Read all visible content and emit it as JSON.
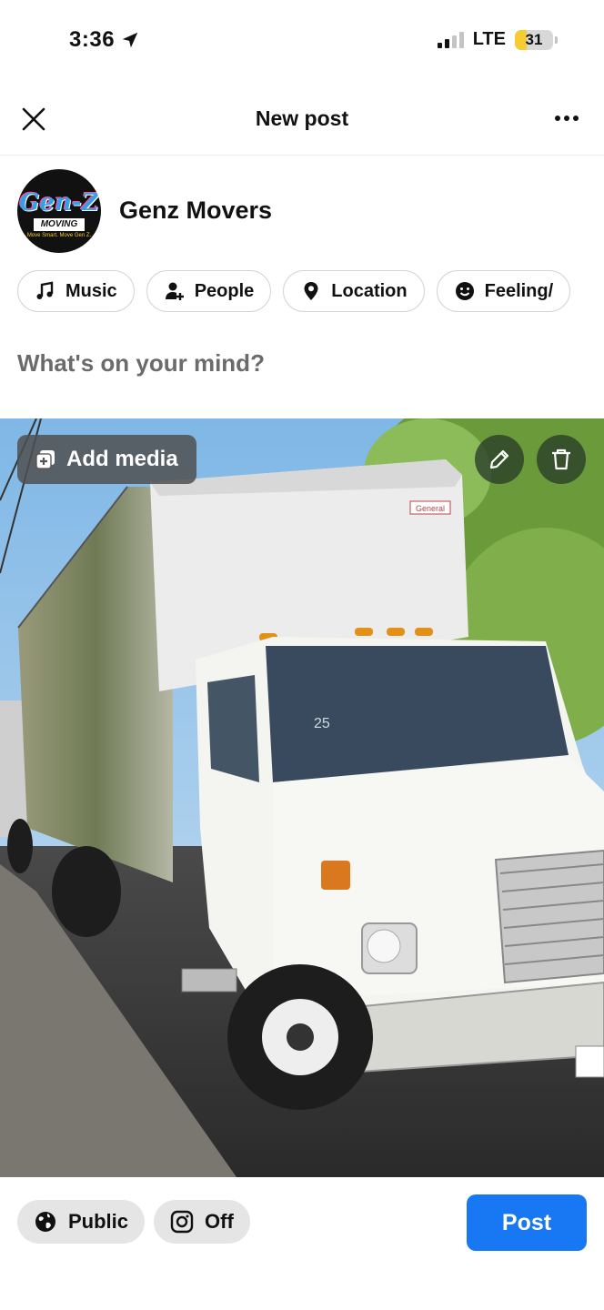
{
  "status_bar": {
    "time": "3:36",
    "network": "LTE",
    "battery": "31",
    "battery_level": 0.31
  },
  "header": {
    "title": "New post"
  },
  "profile": {
    "name": "Genz Movers",
    "avatar_logo_text": "Gen-Z",
    "avatar_logo_sub": "MOVING",
    "avatar_logo_tagline": "Move Smart. Move Gen Z."
  },
  "chips": [
    {
      "label": "Music",
      "icon": "music-note-icon"
    },
    {
      "label": "People",
      "icon": "person-add-icon"
    },
    {
      "label": "Location",
      "icon": "location-pin-icon"
    },
    {
      "label": "Feeling/",
      "icon": "smiley-icon"
    }
  ],
  "composer": {
    "placeholder": "What's on your mind?"
  },
  "media": {
    "add_label": "Add media",
    "truck_box_label": "General",
    "truck_number": "25"
  },
  "footer": {
    "audience": "Public",
    "instagram": "Off",
    "post": "Post"
  },
  "colors": {
    "accent": "#1877f2",
    "battery": "#f6cc30"
  }
}
